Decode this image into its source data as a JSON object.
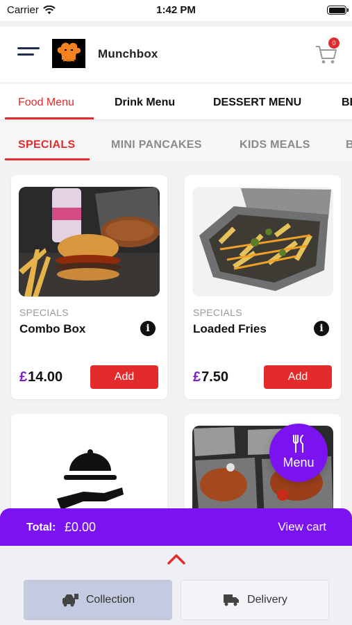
{
  "status_bar": {
    "carrier": "Carrier",
    "time": "1:42 PM"
  },
  "header": {
    "brand": "Munchbox",
    "cart_count": "0"
  },
  "menu_tabs": [
    {
      "label": "Food Menu",
      "active": true
    },
    {
      "label": "Drink Menu",
      "active": false
    },
    {
      "label": "DESSERT MENU",
      "active": false
    },
    {
      "label": "BE",
      "active": false
    }
  ],
  "category_tabs": [
    {
      "label": "SPECIALS",
      "active": true
    },
    {
      "label": "MINI PANCAKES",
      "active": false
    },
    {
      "label": "KIDS MEALS",
      "active": false
    },
    {
      "label": "B",
      "active": false
    }
  ],
  "products": [
    {
      "category": "SPECIALS",
      "name": "Combo Box",
      "currency": "£",
      "price": "14.00",
      "add_label": "Add"
    },
    {
      "category": "SPECIALS",
      "name": "Loaded Fries",
      "currency": "£",
      "price": "7.50",
      "add_label": "Add"
    }
  ],
  "menu_fab": {
    "label": "Menu"
  },
  "total_bar": {
    "label": "Total:",
    "value": "£0.00",
    "view_cart": "View cart"
  },
  "order_options": {
    "collection": "Collection",
    "delivery": "Delivery"
  },
  "colors": {
    "accent": "#e32b2b",
    "purple": "#7b12f0",
    "price_currency": "#7a22c9"
  },
  "icons": [
    "wifi-icon",
    "battery-icon",
    "hamburger-icon",
    "chef-logo-icon",
    "cart-icon",
    "info-icon",
    "cloche-icon",
    "cutlery-icon",
    "chevron-up-icon",
    "collection-icon",
    "delivery-icon"
  ]
}
